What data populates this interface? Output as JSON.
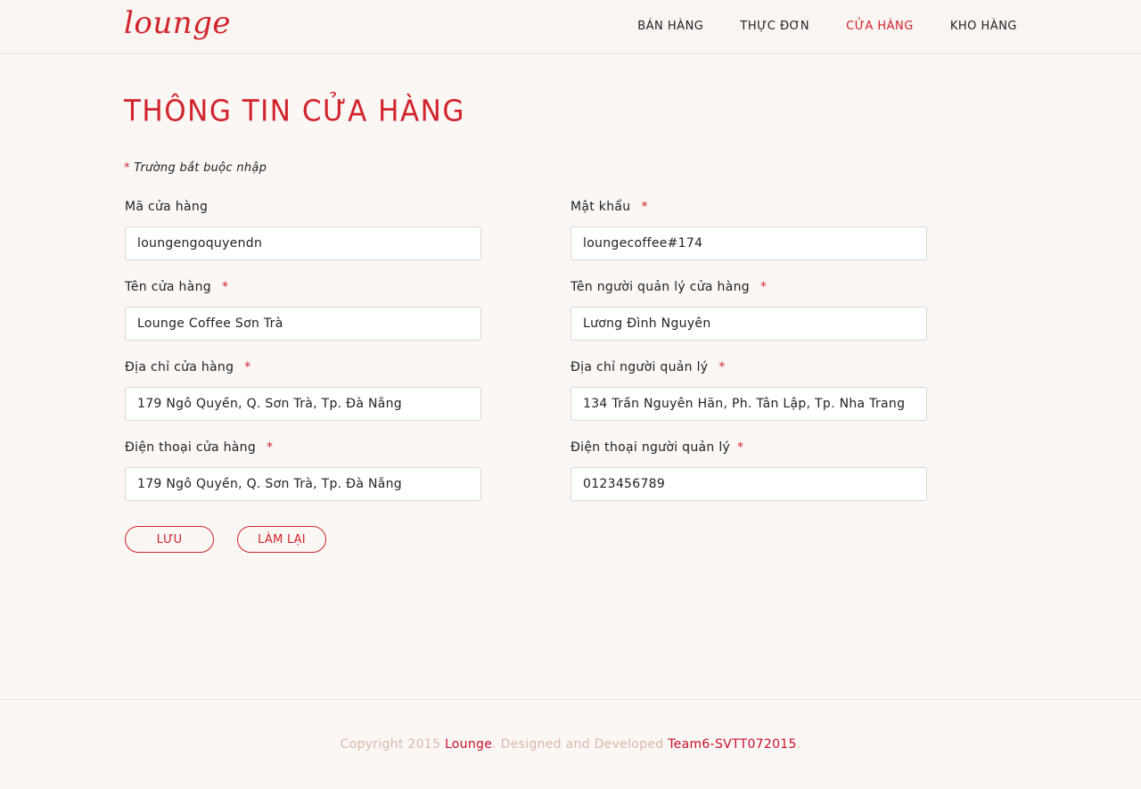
{
  "brand": {
    "logo_text": "lounge"
  },
  "nav": {
    "items": [
      {
        "label": "BÁN HÀNG"
      },
      {
        "label": "THỰC ĐƠN"
      },
      {
        "label": "CỬA HÀNG"
      },
      {
        "label": "KHO HÀNG"
      }
    ],
    "active": "CỬA HÀNG"
  },
  "page": {
    "title": "THÔNG TIN CỬA HÀNG",
    "required_marker": "*",
    "required_note": "Trường bắt buộc nhập"
  },
  "form": {
    "store_code": {
      "label": "Mã cửa hàng",
      "value": "loungengoquyendn"
    },
    "password": {
      "label": "Mật khẩu",
      "value": "loungecoffee#174"
    },
    "store_name": {
      "label": "Tên cửa hàng",
      "value": "Lounge Coffee Sơn Trà"
    },
    "manager_name": {
      "label": "Tên người quản lý cửa hàng",
      "value": "Lương Đình Nguyên"
    },
    "store_address": {
      "label": "Địa chỉ cửa hàng",
      "value": "179 Ngô Quyền, Q. Sơn Trà, Tp. Đà Nẵng"
    },
    "manager_address": {
      "label": "Địa chỉ người quản lý",
      "value": "134 Trần Nguyên Hãn, Ph. Tân Lập, Tp. Nha Trang"
    },
    "store_phone": {
      "label": "Điện thoại cửa hàng",
      "value": "179 Ngô Quyền, Q. Sơn Trà, Tp. Đà Nẵng"
    },
    "manager_phone": {
      "label": "Điện thoại người quản lý",
      "value": "0123456789"
    }
  },
  "buttons": {
    "save": "LƯU",
    "reset": "LÀM LẠI"
  },
  "footer": {
    "prefix": "Copyright 2015 ",
    "brand": "Lounge",
    "middle": ". Designed and Developed ",
    "team": "Team6-SVTT072015",
    "suffix": "."
  },
  "colors": {
    "accent": "#d2232a",
    "background": "#faf7f5",
    "footer_text": "#d9b8a8"
  }
}
